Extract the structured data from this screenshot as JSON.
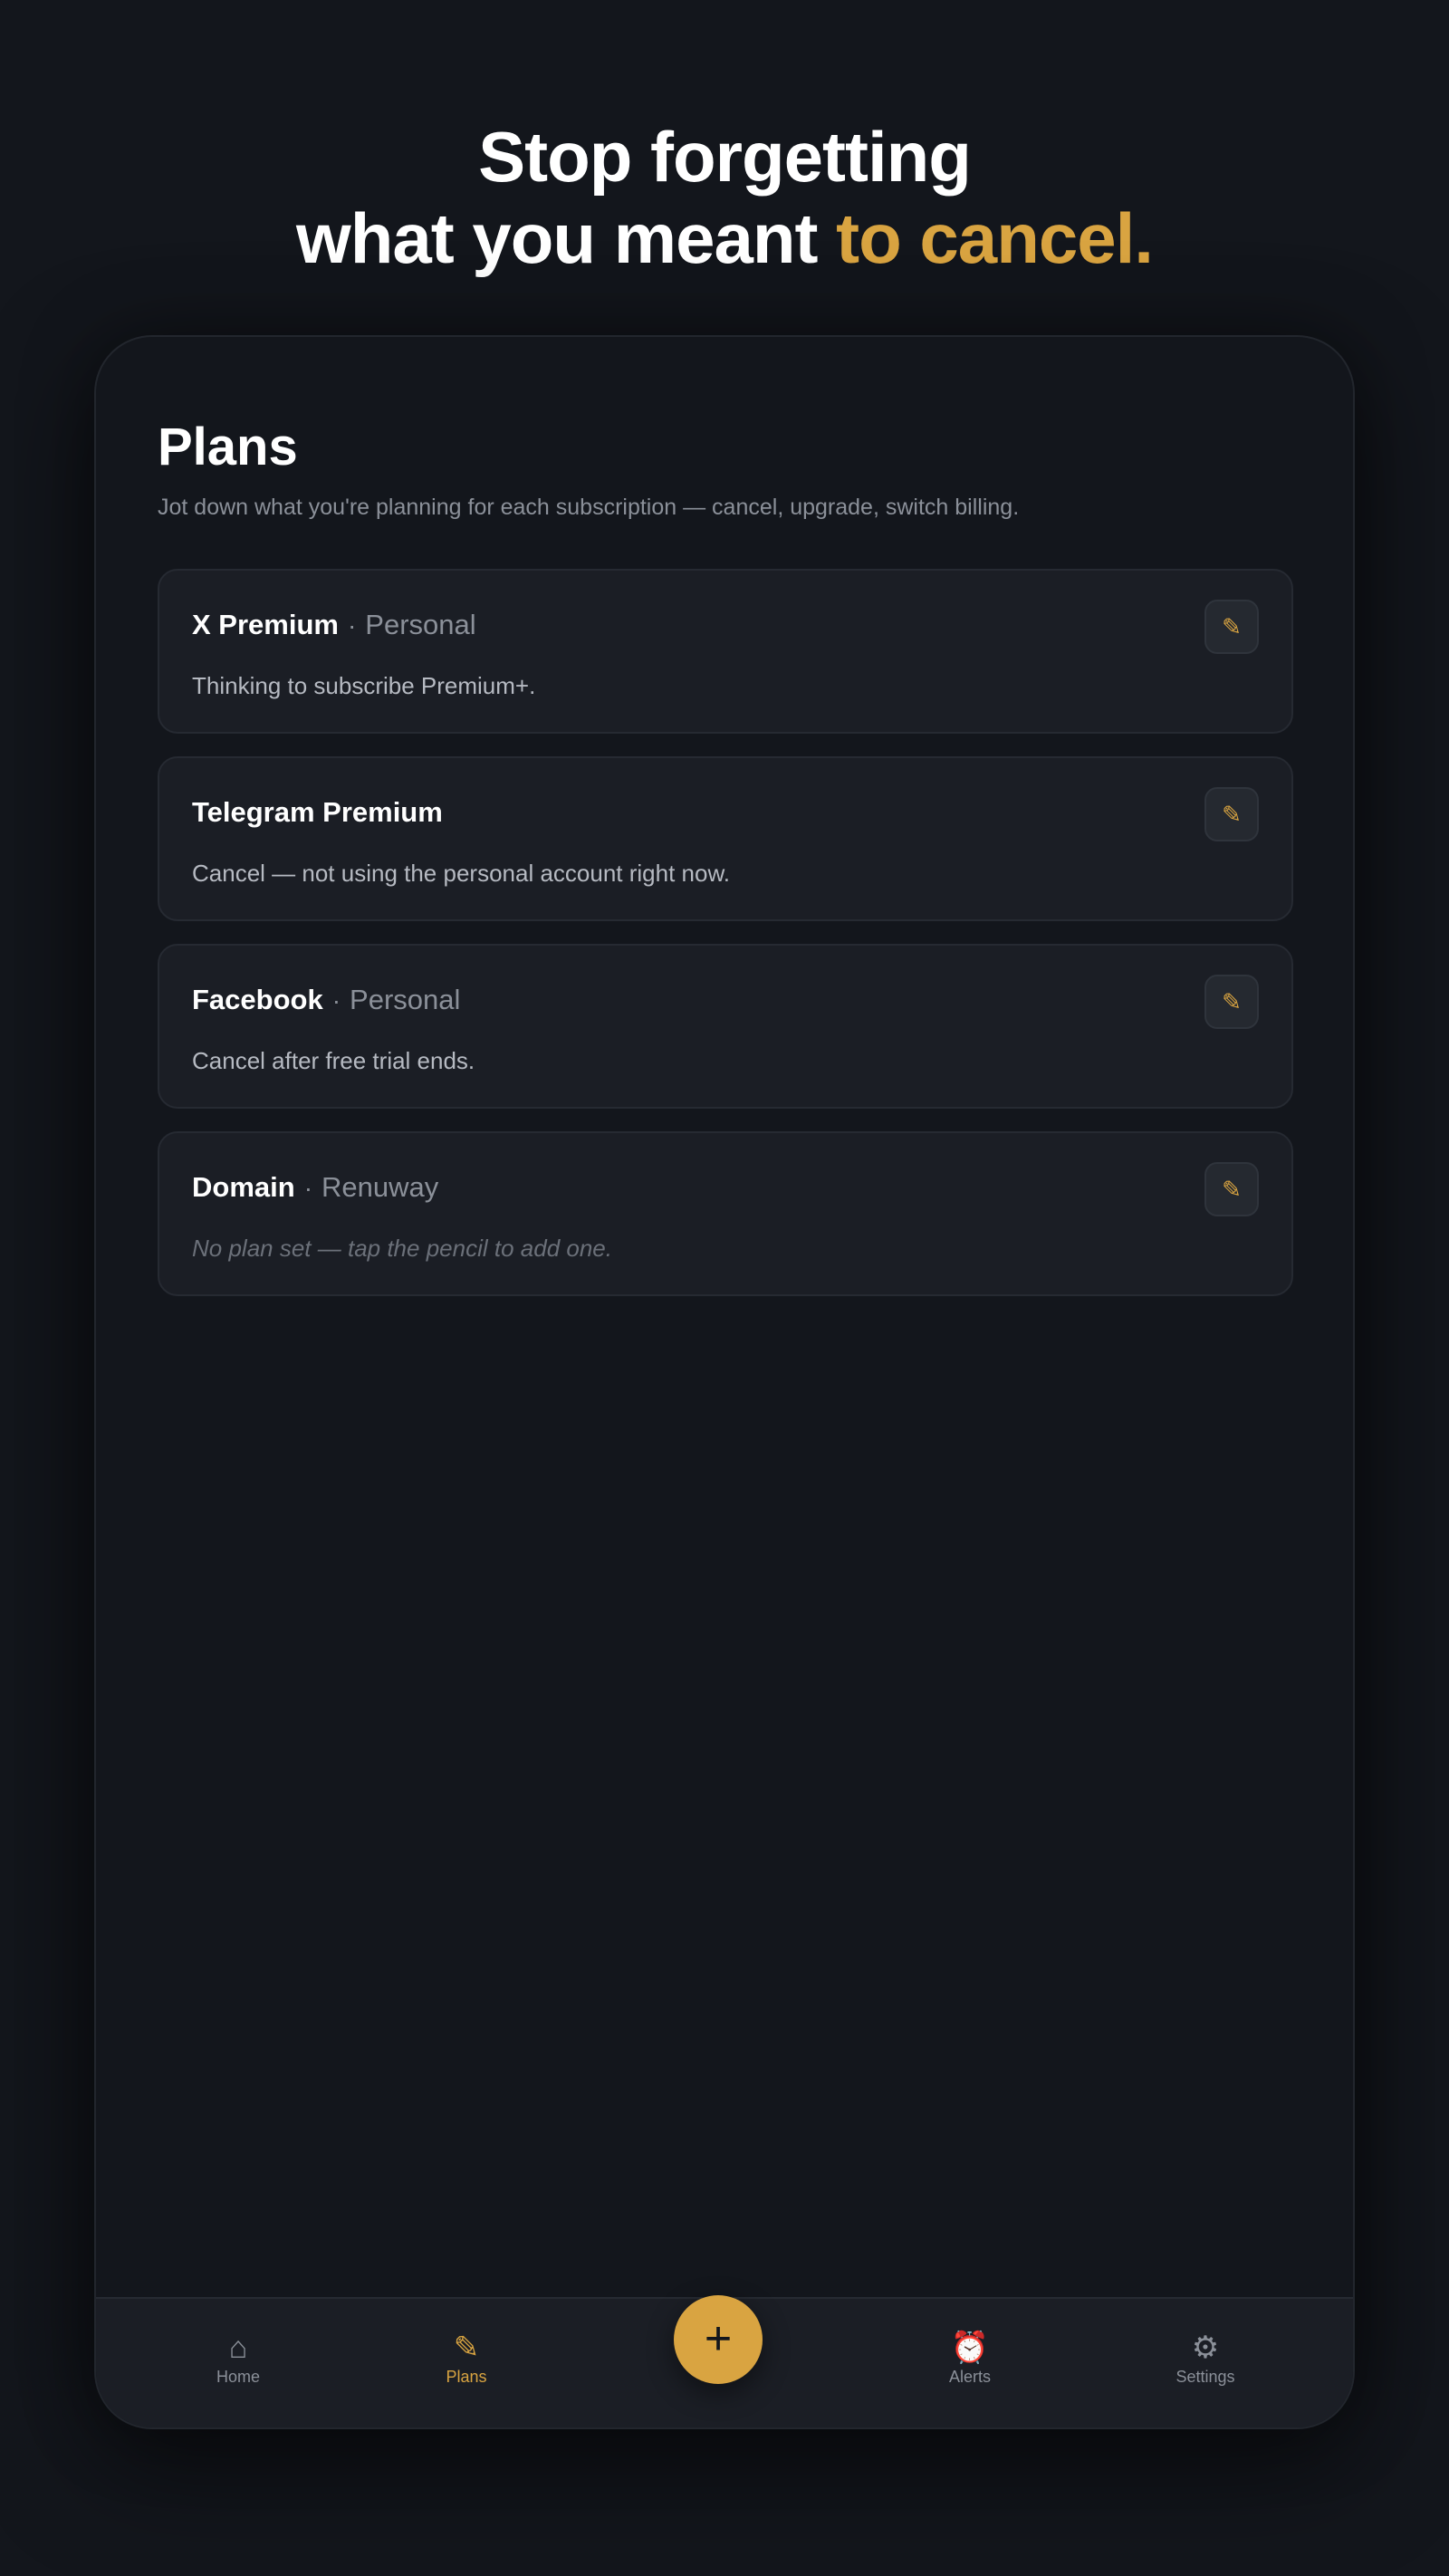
{
  "hero": {
    "line1": "Stop forgetting",
    "line2_plain": "what you meant ",
    "line2_accent": "to cancel."
  },
  "colors": {
    "accent": "#d9a441",
    "background": "#13161c",
    "card": "#1b1e25",
    "muted_text": "#8b9099",
    "alarm": "#e0463c"
  },
  "page": {
    "title": "Plans",
    "subtitle": "Jot down what you're planning for each subscription — cancel, upgrade, switch billing."
  },
  "plans": [
    {
      "name": "X Premium",
      "separator": "·",
      "account": "Personal",
      "note": "Thinking to subscribe Premium+.",
      "edit_icon": "✎"
    },
    {
      "name": "Telegram Premium",
      "separator": "",
      "account": "",
      "note": "Cancel — not using the personal account right now.",
      "edit_icon": "✎"
    },
    {
      "name": "Facebook",
      "separator": "·",
      "account": "Personal",
      "note": "Cancel after free trial ends.",
      "edit_icon": "✎"
    },
    {
      "name": "Domain",
      "separator": "·",
      "account": "Renuway",
      "note": "No plan set — tap the pencil to add one.",
      "edit_icon": "✎"
    }
  ],
  "tabbar": {
    "home": {
      "icon": "⌂",
      "icon_name": "home-icon",
      "label": "Home"
    },
    "plans": {
      "icon": "✎",
      "icon_name": "pencil-icon",
      "label": "Plans"
    },
    "add": {
      "icon": "+",
      "icon_name": "plus-icon"
    },
    "alerts": {
      "icon": "⏰",
      "icon_name": "alarm-clock-icon",
      "label": "Alerts"
    },
    "settings": {
      "icon": "⚙",
      "icon_name": "gear-icon",
      "label": "Settings"
    },
    "active": "Plans"
  }
}
